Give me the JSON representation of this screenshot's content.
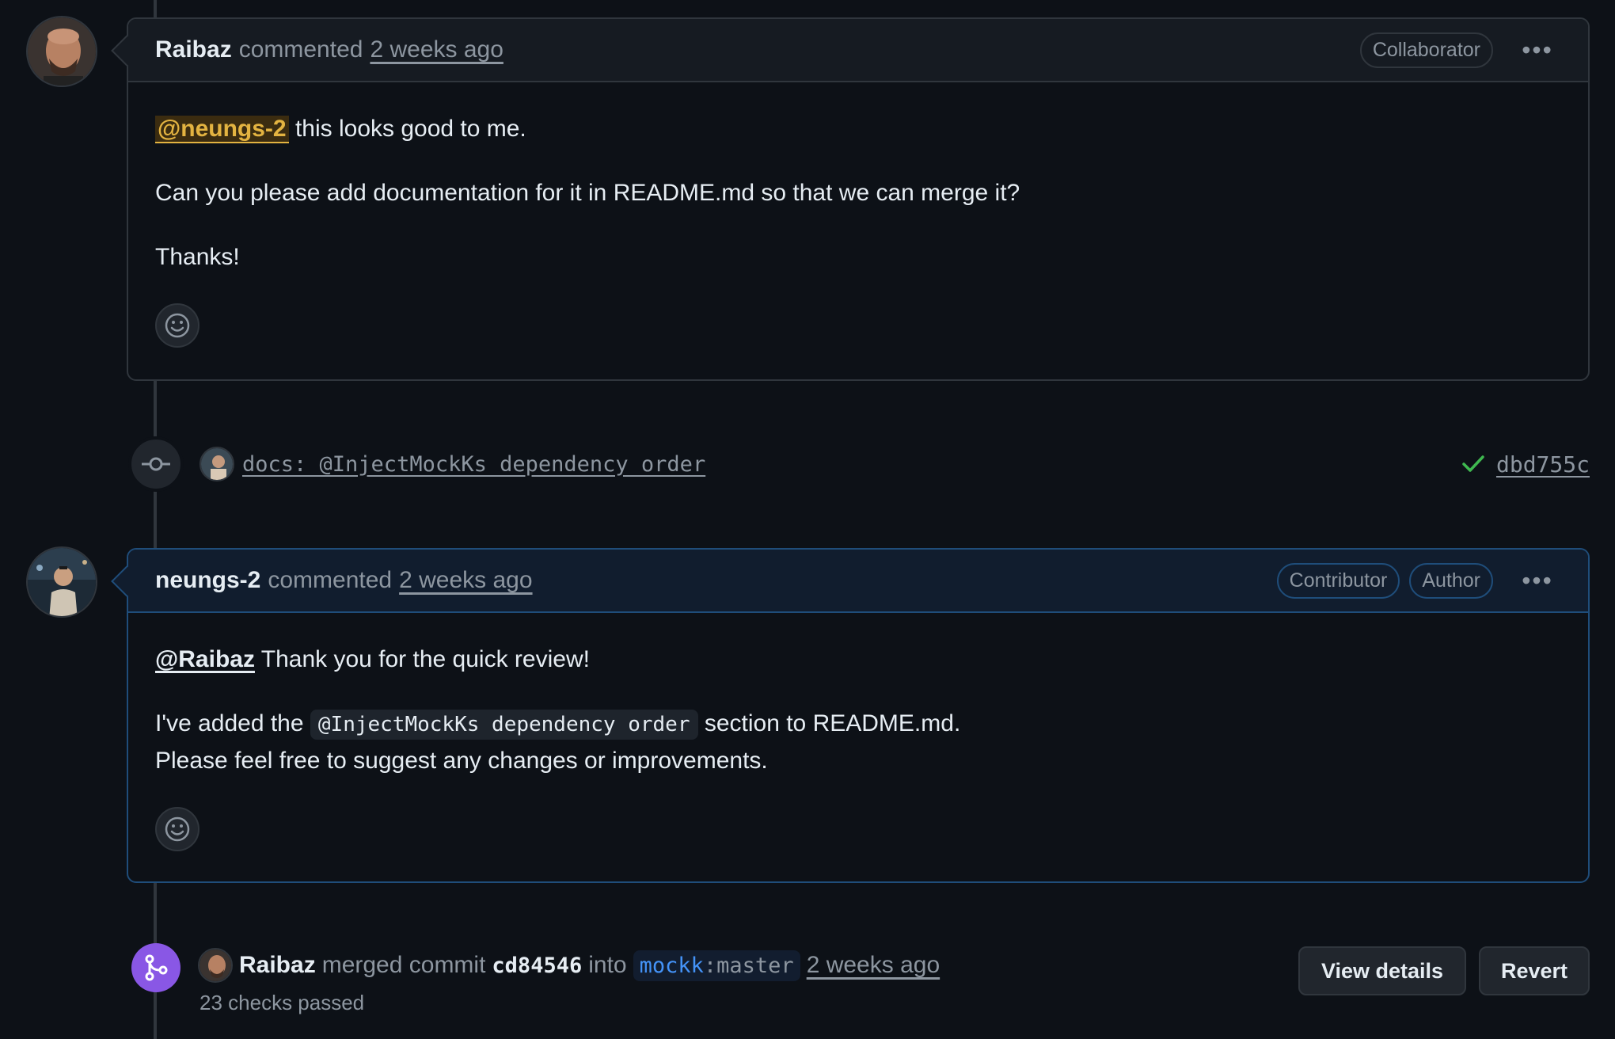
{
  "comments": [
    {
      "author": "Raibaz",
      "action": "commented",
      "time": "2 weeks ago",
      "badges": [
        "Collaborator"
      ],
      "mention": "@neungs-2",
      "line1_rest": " this looks good to me.",
      "line2": "Can you please add documentation for it in README.md so that we can merge it?",
      "line3": "Thanks!"
    },
    {
      "author": "neungs-2",
      "action": "commented",
      "time": "2 weeks ago",
      "badges": [
        "Contributor",
        "Author"
      ],
      "mention": "@Raibaz",
      "line1_rest": " Thank you for the quick review!",
      "line2_pre": "I've added the ",
      "line2_code": "@InjectMockKs dependency order",
      "line2_post": " section to README.md.",
      "line3": "Please feel free to suggest any changes or improvements."
    }
  ],
  "commit": {
    "message": "docs: @InjectMockKs dependency order",
    "sha": "dbd755c",
    "status_color": "#3fb950"
  },
  "merge": {
    "author": "Raibaz",
    "text1": "merged commit",
    "commit": "cd84546",
    "text2": "into",
    "branch_owner": "mockk",
    "branch_sep": ":",
    "branch_name": "master",
    "time": "2 weeks ago",
    "checks": "23 checks passed",
    "view_details": "View details",
    "revert": "Revert"
  },
  "icons": {
    "more": "kebab-horizontal-icon",
    "reaction": "smiley-icon",
    "commit": "git-commit-icon",
    "check": "check-icon",
    "merge": "git-merge-icon"
  },
  "colors": {
    "background": "#0d1117",
    "merge_purple": "#8957e5",
    "mention_yellow": "#e3b341",
    "link_blue": "#4493f8"
  }
}
